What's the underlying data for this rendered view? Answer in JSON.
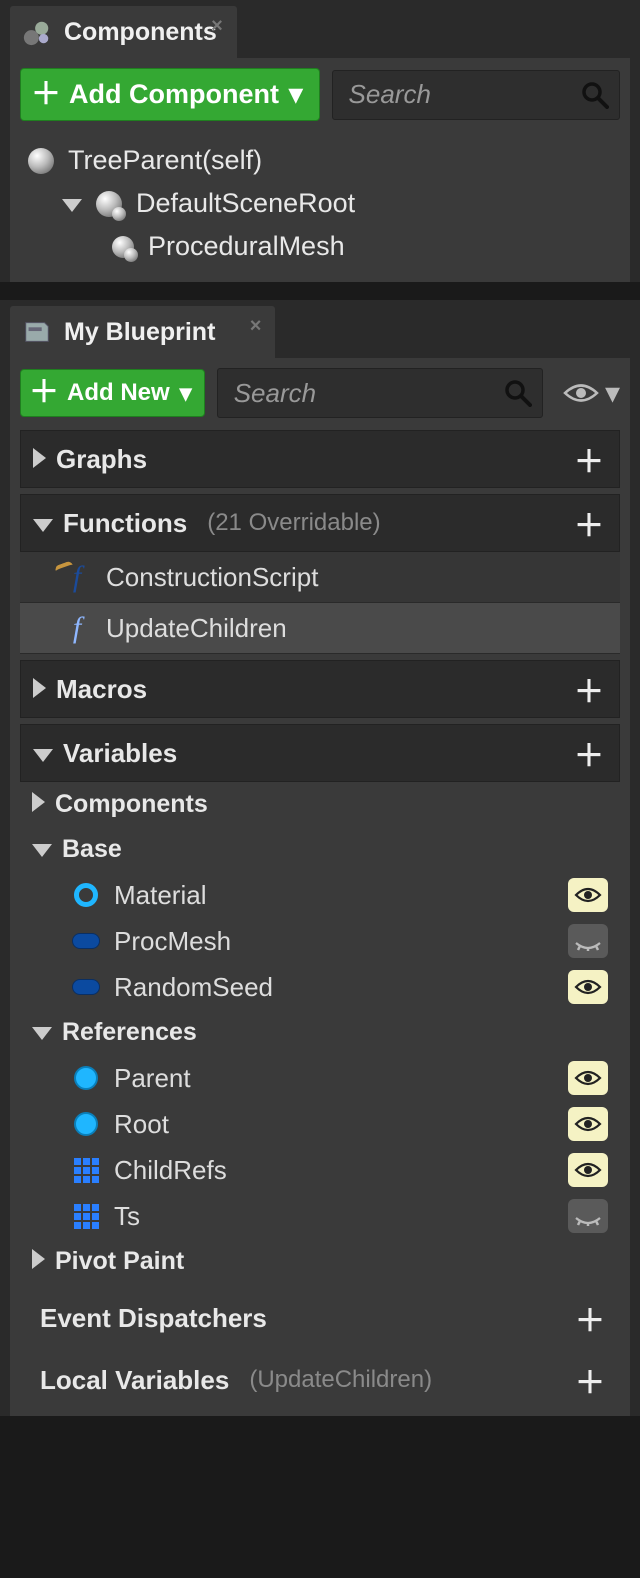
{
  "components_panel": {
    "title": "Components",
    "add_button": "Add Component",
    "search_placeholder": "Search",
    "tree": {
      "root": "TreeParent(self)",
      "scene_root": "DefaultSceneRoot",
      "child1": "ProceduralMesh"
    }
  },
  "blueprint_panel": {
    "title": "My Blueprint",
    "add_button": "Add New",
    "search_placeholder": "Search",
    "sections": {
      "graphs": {
        "label": "Graphs"
      },
      "functions": {
        "label": "Functions",
        "hint": "(21 Overridable)",
        "items": {
          "cs": "ConstructionScript",
          "uc": "UpdateChildren"
        }
      },
      "macros": {
        "label": "Macros"
      },
      "variables": {
        "label": "Variables",
        "groups": {
          "components": "Components",
          "base": {
            "label": "Base",
            "material": "Material",
            "procmesh": "ProcMesh",
            "randomseed": "RandomSeed"
          },
          "references": {
            "label": "References",
            "parent": "Parent",
            "root": "Root",
            "childrefs": "ChildRefs",
            "ts": "Ts"
          },
          "pivotpaint": "Pivot Paint"
        }
      },
      "event_dispatchers": {
        "label": "Event Dispatchers"
      },
      "local_variables": {
        "label": "Local Variables",
        "hint": "(UpdateChildren)"
      }
    }
  }
}
